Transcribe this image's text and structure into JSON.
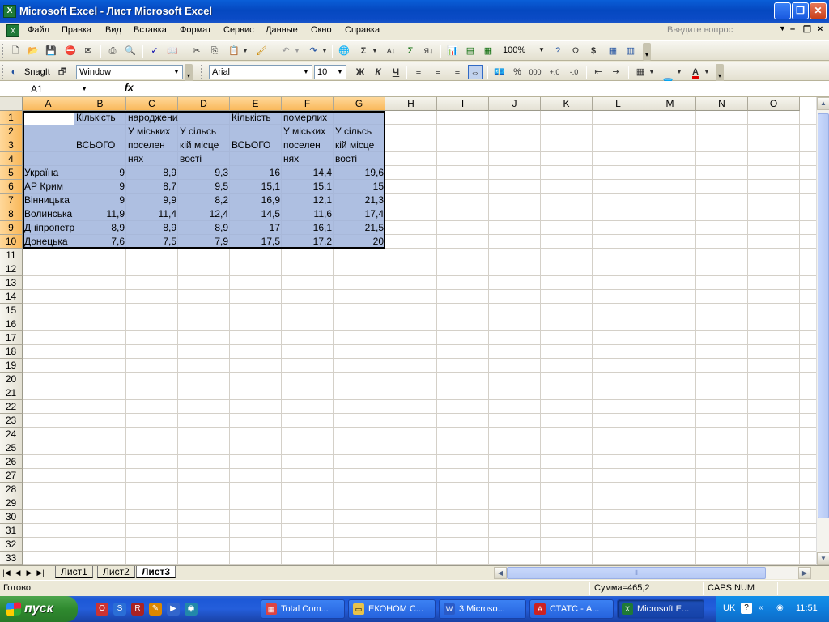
{
  "window": {
    "title": "Microsoft Excel - Лист Microsoft Excel",
    "app_icon": "excel-icon",
    "minimize": "minimize-icon",
    "restore": "restore-icon",
    "close": "close-icon"
  },
  "menubar": {
    "items": [
      "Файл",
      "Правка",
      "Вид",
      "Вставка",
      "Формат",
      "Сервис",
      "Данные",
      "Окно",
      "Справка"
    ],
    "ask_placeholder": "Введите вопрос"
  },
  "toolbar_standard": {
    "zoom": "100%"
  },
  "toolbar_format": {
    "snagit_label": "SnagIt",
    "snagit_profile": "Window",
    "font_name": "Arial",
    "font_size": "10",
    "bold_label": "Ж",
    "italic_label": "К",
    "underline_label": "Ч",
    "font_color": "#e00000",
    "fill_color": "#ffff00"
  },
  "formula_bar": {
    "name_box": "A1",
    "fx_label": "fx",
    "content": ""
  },
  "columns": [
    "A",
    "B",
    "C",
    "D",
    "E",
    "F",
    "G",
    "H",
    "I",
    "J",
    "K",
    "L",
    "M",
    "N",
    "O"
  ],
  "rows": [
    "1",
    "2",
    "3",
    "4",
    "5",
    "6",
    "7",
    "8",
    "9",
    "10",
    "11",
    "12",
    "13",
    "14",
    "15",
    "16",
    "17",
    "18",
    "19",
    "20",
    "21",
    "22",
    "23",
    "24",
    "25",
    "26",
    "27",
    "28",
    "29",
    "30",
    "31",
    "32",
    "33"
  ],
  "cells": {
    "B1": "Кількість",
    "C1": "народжених",
    "E1": "Кількість",
    "F1": "померлих",
    "C2": "У міських",
    "C3": "поселен",
    "C4": "нях",
    "D2": "У сільсь",
    "D3": "кій місце",
    "D4": "вості",
    "F2": "У міських",
    "F3": "поселен",
    "F4": "нях",
    "G2": "У сільсь",
    "G3": "кій місце",
    "G4": "вості",
    "B3": "ВСЬОГО",
    "E3": "ВСЬОГО"
  },
  "data_rows": [
    {
      "region": "Україна",
      "b": "9",
      "c": "8,9",
      "d": "9,3",
      "e": "16",
      "f": "14,4",
      "g": "19,6"
    },
    {
      "region": "АР Крим",
      "b": "9",
      "c": "8,7",
      "d": "9,5",
      "e": "15,1",
      "f": "15,1",
      "g": "15"
    },
    {
      "region": "Вінницька",
      "b": "9",
      "c": "9,9",
      "d": "8,2",
      "e": "16,9",
      "f": "12,1",
      "g": "21,3"
    },
    {
      "region": "Волинська",
      "b": "11,9",
      "c": "11,4",
      "d": "12,4",
      "e": "14,5",
      "f": "11,6",
      "g": "17,4"
    },
    {
      "region": "Дніпропетровська",
      "b": "8,9",
      "c": "8,9",
      "d": "8,9",
      "e": "17",
      "f": "16,1",
      "g": "21,5"
    },
    {
      "region": "Донецька",
      "b": "7,6",
      "c": "7,5",
      "d": "7,9",
      "e": "17,5",
      "f": "17,2",
      "g": "20"
    }
  ],
  "sheets": [
    {
      "name": "Лист1",
      "active": false
    },
    {
      "name": "Лист2",
      "active": false
    },
    {
      "name": "Лист3",
      "active": true
    }
  ],
  "statusbar": {
    "ready": "Готово",
    "sum": "Сумма=465,2",
    "keys": "CAPS NUM"
  },
  "taskbar": {
    "start_label": "пуск",
    "tasks": [
      {
        "label": "Total Com...",
        "icon": "total-commander-icon",
        "active": false
      },
      {
        "label": "ЕКОНОМ С...",
        "icon": "folder-icon",
        "active": false
      },
      {
        "label": "3 Microso...",
        "icon": "word-icon",
        "active": false
      },
      {
        "label": "СТАТС - А...",
        "icon": "acrobat-icon",
        "active": false
      },
      {
        "label": "Microsoft E...",
        "icon": "excel-icon",
        "active": true
      }
    ],
    "lang": "UK",
    "clock": "11:51"
  }
}
